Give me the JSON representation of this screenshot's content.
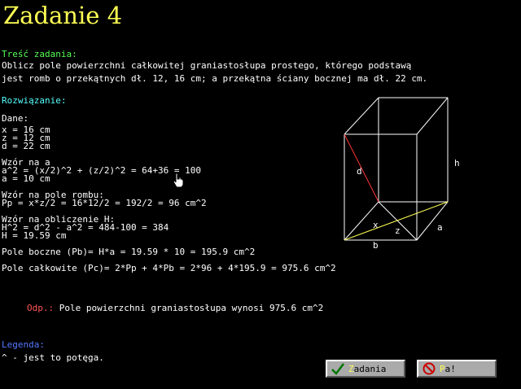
{
  "title": "Zadanie 4",
  "task": {
    "heading": "Treść zadania:",
    "line1": "Oblicz pole powierzchni całkowitej graniastosłupa prostego, którego podstawą",
    "line2": "jest romb o przekątnych dł. 12, 16 cm; a przekątna ściany bocznej ma dł. 22 cm."
  },
  "solution": {
    "heading": "Rozwiązanie:",
    "given_heading": "Dane:",
    "given": [
      "x = 16 cm",
      "z = 12 cm",
      "d = 22 cm"
    ],
    "a_heading": "Wzór na a",
    "a_lines": [
      "a^2 = (x/2)^2 + (z/2)^2 = 64+36 = 100",
      "a = 10 cm"
    ],
    "pp_heading": "Wzór na pole rombu:",
    "pp_line": "Pp = x*z/2 = 16*12/2 = 192/2 = 96 cm^2",
    "h_heading": "Wzór na obliczenie H:",
    "h_lines": [
      "H^2 = d^2 - a^2 = 484-100 = 384",
      "H = 19.59 cm"
    ],
    "pb_line": "Pole boczne (Pb)= H*a = 19.59 * 10 = 195.9 cm^2",
    "pc_line": "Pole całkowite (Pc)= 2*Pp + 4*Pb = 2*96 + 4*195.9 = 975.6 cm^2"
  },
  "answer": {
    "label": "Odp.:",
    "text": "Pole powierzchni graniastosłupa wynosi 975.6 cm^2"
  },
  "legend": {
    "heading": "Legenda:",
    "text": "^ - jest to potęga."
  },
  "diagram": {
    "labels": {
      "d": "d",
      "h": "h",
      "x": "x",
      "z": "z",
      "a": "a",
      "b": "b"
    }
  },
  "buttons": {
    "tasks": {
      "first": "Z",
      "rest": "adania",
      "icon": "checkmark-icon"
    },
    "pause": {
      "first": "P",
      "rest": "a!",
      "icon": "no-entry-icon"
    }
  }
}
